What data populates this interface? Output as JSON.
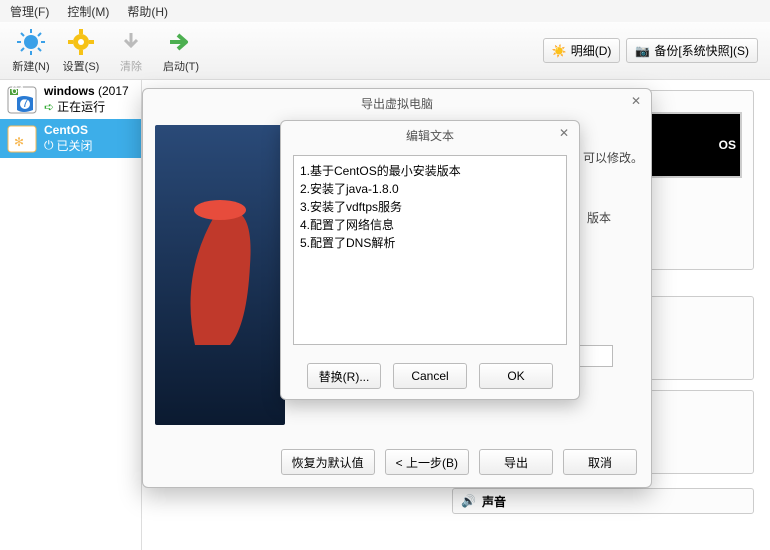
{
  "menu": {
    "file": "管理(F)",
    "control": "控制(M)",
    "help": "帮助(H)"
  },
  "toolbar": {
    "new": "新建(N)",
    "settings": "设置(S)",
    "clear": "清除",
    "start": "启动(T)",
    "detail": "明细(D)",
    "snapshot": "备份[系统快照](S)"
  },
  "vms": [
    {
      "name": "windows",
      "ver": "(2017",
      "status": "正在运行"
    },
    {
      "name": "CentOS",
      "status": "已关闭"
    }
  ],
  "preview_text": "OS",
  "sound": "声音",
  "dlg1": {
    "title": "导出虚拟电脑",
    "hint1": "可以修改。",
    "hint2": "版本",
    "buttons": {
      "restore": "恢复为默认值",
      "prev": "< 上一步(B)",
      "export": "导出",
      "cancel": "取消"
    }
  },
  "dlg2": {
    "title": "编辑文本",
    "text": "1.基于CentOS的最小安装版本\n2.安装了java-1.8.0\n3.安装了vdftps服务\n4.配置了网络信息\n5.配置了DNS解析",
    "buttons": {
      "replace": "替换(R)...",
      "cancel": "Cancel",
      "ok": "OK"
    }
  }
}
